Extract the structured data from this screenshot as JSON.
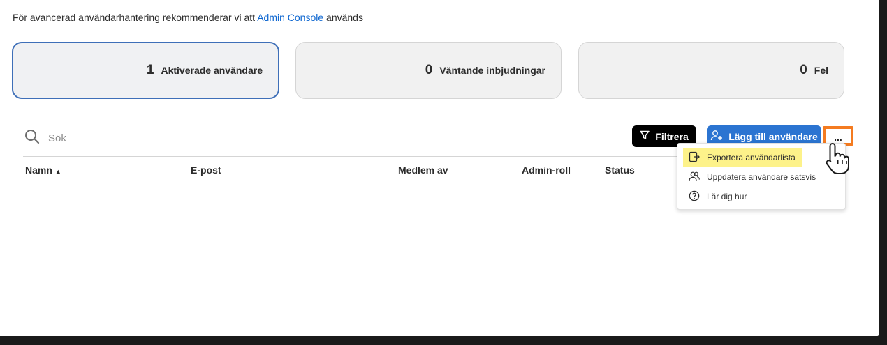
{
  "intro": {
    "prefix": "För avancerad användarhantering rekommenderar vi att",
    "link": "Admin Console",
    "suffix": "används"
  },
  "stats": [
    {
      "count": "1",
      "label": "Aktiverade användare",
      "active": true
    },
    {
      "count": "0",
      "label": "Väntande inbjudningar",
      "active": false
    },
    {
      "count": "0",
      "label": "Fel",
      "active": false
    }
  ],
  "search": {
    "placeholder": "Sök",
    "icon": "search-icon"
  },
  "toolbar": {
    "filter_label": "Filtrera",
    "add_user_label": "Lägg till användare",
    "more_label": "..."
  },
  "table": {
    "columns": [
      "Namn",
      "E-post",
      "Medlem av",
      "Admin-roll",
      "Status"
    ],
    "sort_indicator": "▲"
  },
  "menu": {
    "items": [
      {
        "label": "Exportera användarlista",
        "icon": "export-icon",
        "highlighted": true
      },
      {
        "label": "Uppdatera användare satsvis",
        "icon": "users-icon",
        "highlighted": false
      },
      {
        "label": "Lär dig hur",
        "icon": "help-icon",
        "highlighted": false
      }
    ]
  },
  "colors": {
    "link": "#0d66d0",
    "primary_button": "#2b74d1",
    "highlight": "#fdf28a",
    "annotation": "#f47b20"
  }
}
